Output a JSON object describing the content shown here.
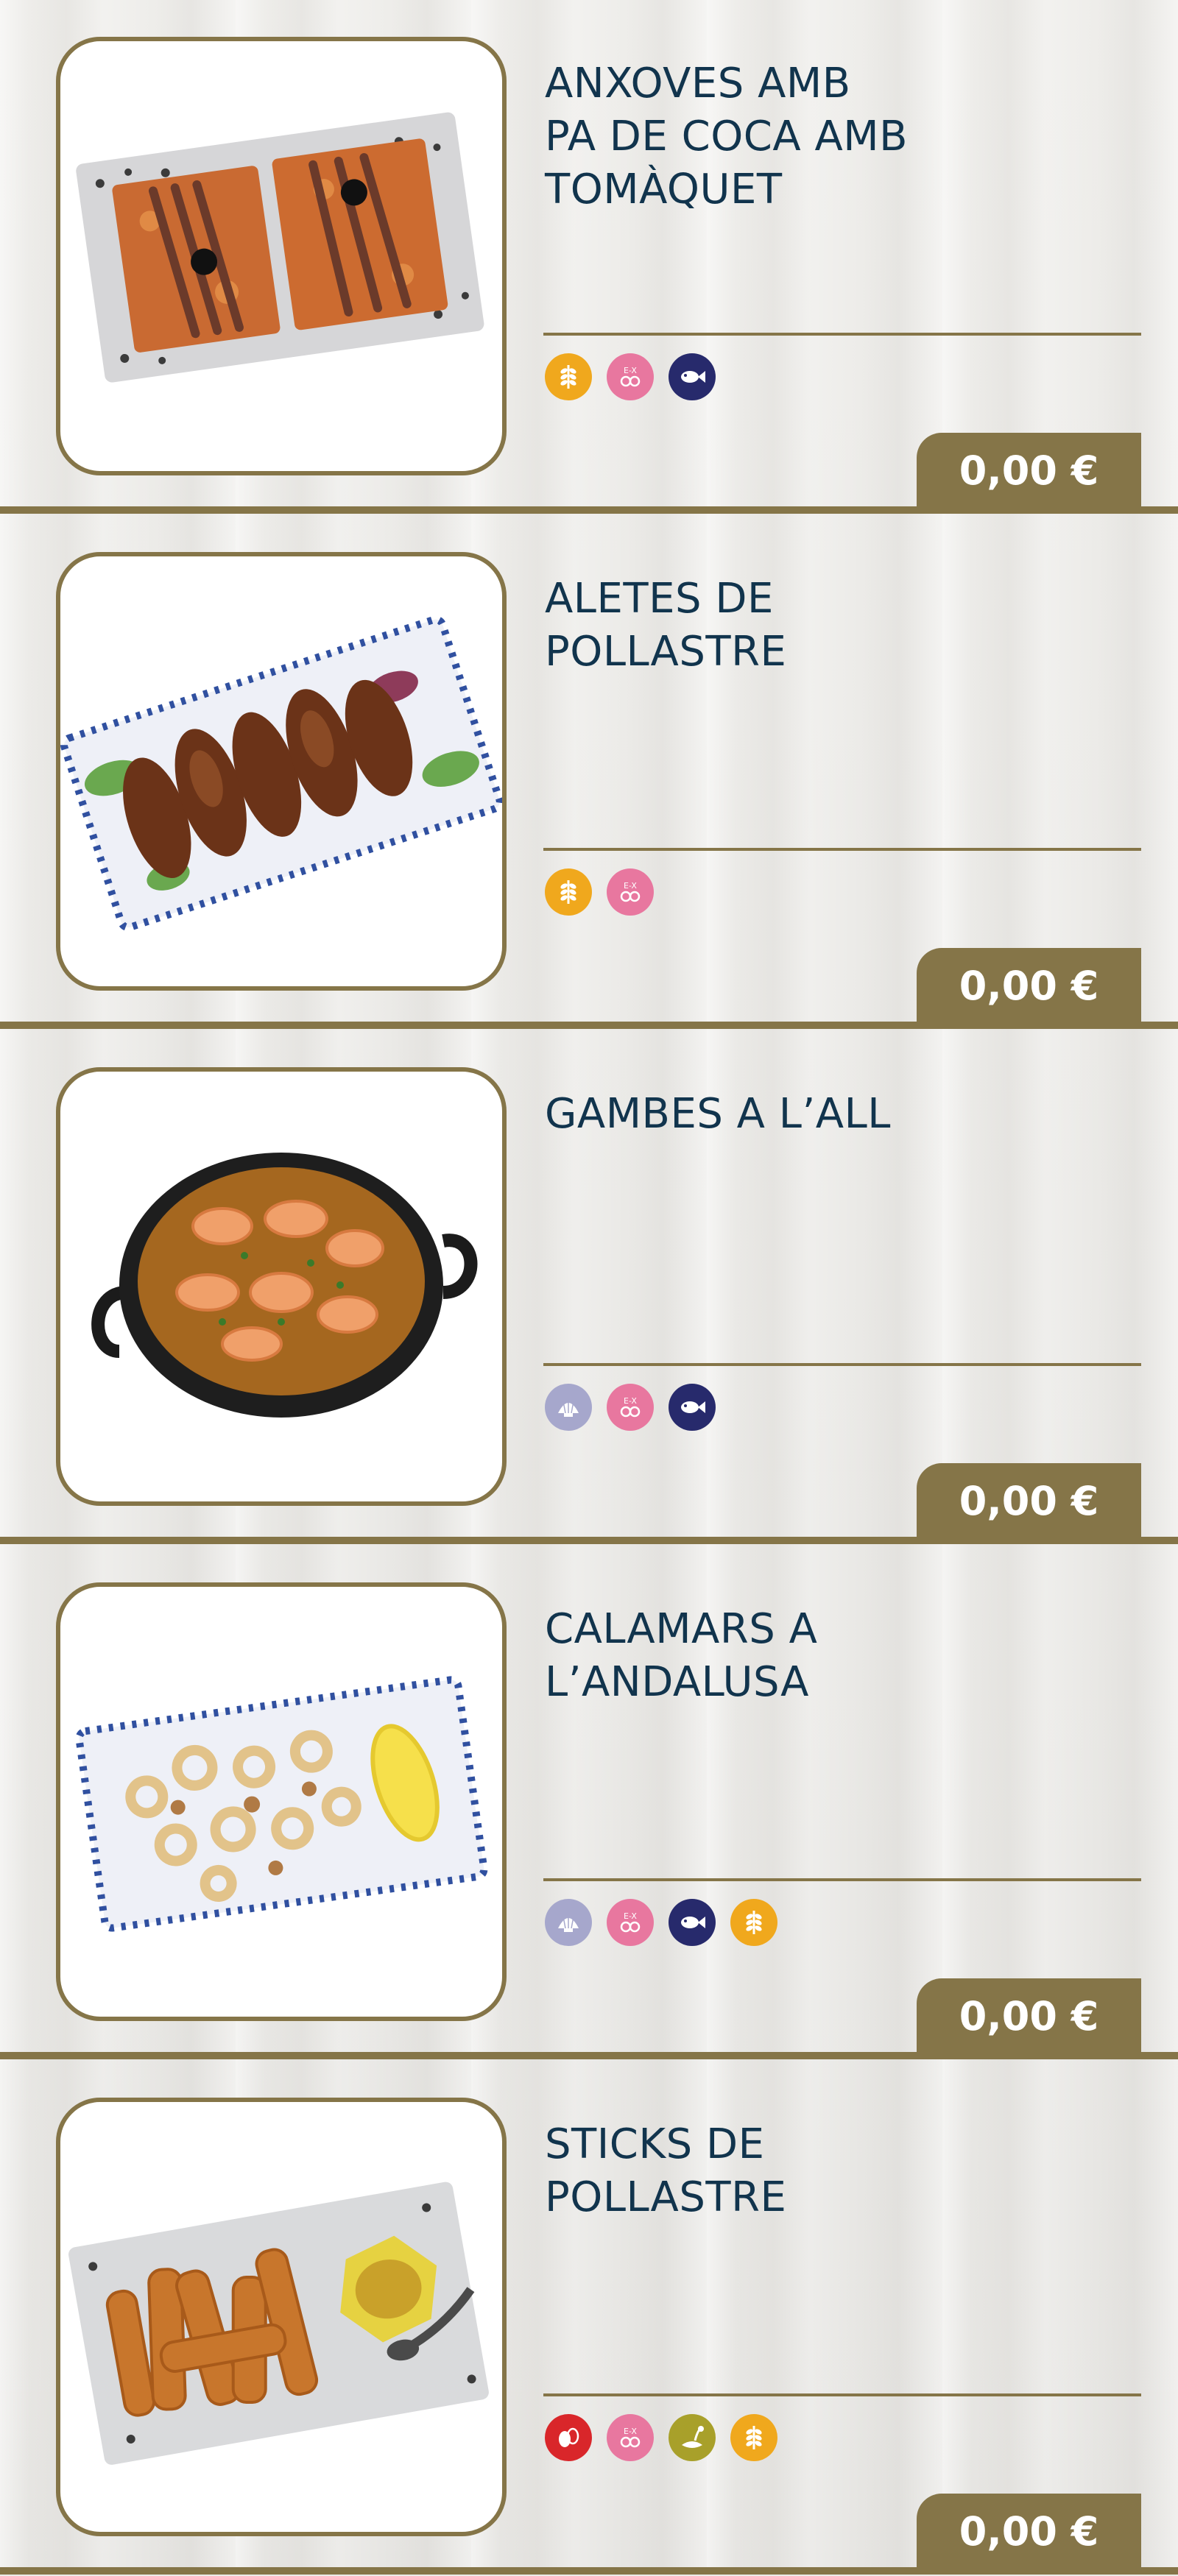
{
  "colors": {
    "accent_gold": "#857548",
    "title_navy": "#11344d",
    "gluten": "#f0a81d",
    "sulphites": "#e8779f",
    "fish": "#272a6c",
    "molluscs": "#a6a7cc",
    "eggs": "#d9262a",
    "mustard": "#a8a02a"
  },
  "items": [
    {
      "name": "ANXOVES AMB\nPA  DE COCA AMB\nTOMÀQUET",
      "price": "0,00 €",
      "photo": "anchovies-on-tomato-bread-photo",
      "allergens": [
        "gluten-icon",
        "sulphites-icon",
        "fish-icon"
      ]
    },
    {
      "name": "ALETES DE\nPOLLASTRE",
      "price": "0,00 €",
      "photo": "chicken-wings-photo",
      "allergens": [
        "gluten-icon",
        "sulphites-icon"
      ]
    },
    {
      "name": "GAMBES A L’ALL",
      "price": "0,00 €",
      "photo": "garlic-prawns-photo",
      "allergens": [
        "molluscs-icon",
        "sulphites-icon",
        "fish-icon"
      ]
    },
    {
      "name": "CALAMARS A\nL’ANDALUSA",
      "price": "0,00 €",
      "photo": "fried-squid-photo",
      "allergens": [
        "molluscs-icon",
        "sulphites-icon",
        "fish-icon",
        "gluten-icon"
      ]
    },
    {
      "name": "STICKS DE\nPOLLASTRE",
      "price": "0,00 €",
      "photo": "chicken-sticks-photo",
      "allergens": [
        "eggs-icon",
        "sulphites-icon",
        "mustard-icon",
        "gluten-icon"
      ]
    }
  ]
}
